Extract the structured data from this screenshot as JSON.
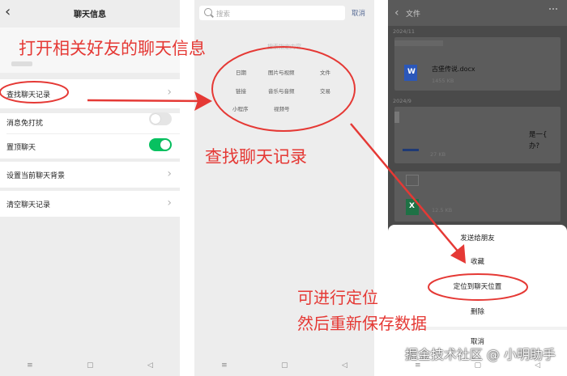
{
  "panel1": {
    "title": "聊天信息",
    "rows": [
      {
        "label": "查找聊天记录"
      },
      {
        "label": "消息免打扰",
        "toggle": "off"
      },
      {
        "label": "置顶聊天",
        "toggle": "on"
      },
      {
        "label": "设置当前聊天背景"
      },
      {
        "label": "清空聊天记录"
      }
    ]
  },
  "panel2": {
    "search_placeholder": "搜索",
    "cancel_label": "取消",
    "hint": "搜索指定内容",
    "categories": [
      "日期",
      "图片与视频",
      "文件",
      "链接",
      "音乐与音频",
      "交易",
      "小程序",
      "视频号"
    ]
  },
  "panel3": {
    "title": "文件",
    "dates": [
      "2024/11",
      "2024/9"
    ],
    "files": [
      {
        "name": "古堡传说.docx",
        "size": "1455 KB"
      },
      {
        "name": "",
        "size": "27 KB"
      },
      {
        "name": "",
        "size": "12.5 KB"
      }
    ],
    "chat_snippet": "是一{",
    "chat_snippet2": "办?",
    "sheet": [
      "发送给朋友",
      "收藏",
      "定位到聊天位置",
      "删除",
      "取消"
    ]
  },
  "nav": {
    "back": "◁",
    "home": "▢",
    "menu": "≡"
  },
  "annotations": {
    "step1": "打开相关好友的聊天信息",
    "step2": "查找聊天记录",
    "step3_line1": "可进行定位",
    "step3_line2": "然后重新保存数据",
    "watermark": "掘金技术社区 @ 小明助手"
  },
  "colors": {
    "toggle_on": "#07c160",
    "annotation": "#e53935",
    "link": "#576b95"
  }
}
